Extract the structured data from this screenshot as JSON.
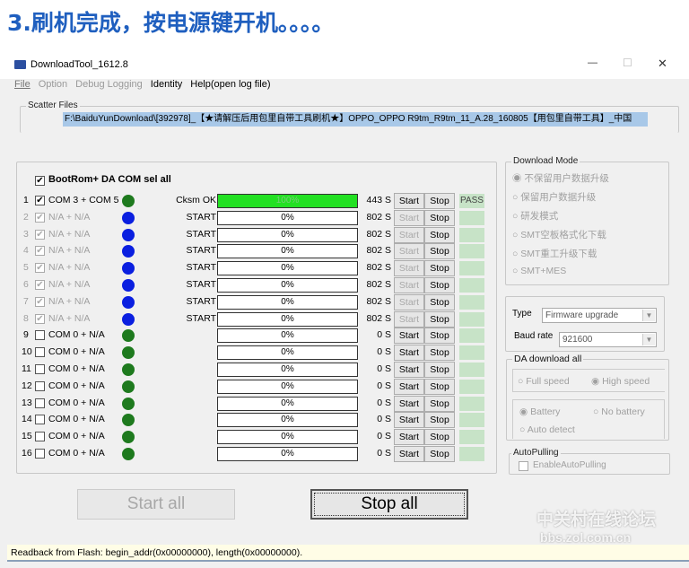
{
  "caption": "3.刷机完成，按电源键开机。。。。",
  "window": {
    "title": "DownloadTool_1612.8",
    "minimize": "—",
    "maximize": "☐",
    "close": "✕"
  },
  "menu": [
    "File",
    "Option",
    "Debug Logging",
    "Identity",
    "Help(open log file)"
  ],
  "scatter": {
    "label": "Scatter Files",
    "path": "F:\\BaiduYunDownload\\[392978]_【★请解压后用包里自带工具刷机★】OPPO_OPPO R9tm_R9tm_11_A.28_160805【用包里自带工具】_中国"
  },
  "sel_all": {
    "label": "BootRom+ DA COM sel all",
    "checked": true
  },
  "rows": [
    {
      "n": "1",
      "com": "COM 3 + COM 5",
      "checked": true,
      "enabled": true,
      "led": "#1e7a1e",
      "status": "Cksm OK",
      "progress": 100,
      "pct": "100%",
      "time": "443 S",
      "start_enabled": true,
      "result": "PASS"
    },
    {
      "n": "2",
      "com": "N/A + N/A",
      "checked": true,
      "enabled": false,
      "led": "#0a1fe0",
      "status": "START",
      "progress": 0,
      "pct": "0%",
      "time": "802 S",
      "start_enabled": false,
      "result": ""
    },
    {
      "n": "3",
      "com": "N/A + N/A",
      "checked": true,
      "enabled": false,
      "led": "#0a1fe0",
      "status": "START",
      "progress": 0,
      "pct": "0%",
      "time": "802 S",
      "start_enabled": false,
      "result": ""
    },
    {
      "n": "4",
      "com": "N/A + N/A",
      "checked": true,
      "enabled": false,
      "led": "#0a1fe0",
      "status": "START",
      "progress": 0,
      "pct": "0%",
      "time": "802 S",
      "start_enabled": false,
      "result": ""
    },
    {
      "n": "5",
      "com": "N/A + N/A",
      "checked": true,
      "enabled": false,
      "led": "#0a1fe0",
      "status": "START",
      "progress": 0,
      "pct": "0%",
      "time": "802 S",
      "start_enabled": false,
      "result": ""
    },
    {
      "n": "6",
      "com": "N/A + N/A",
      "checked": true,
      "enabled": false,
      "led": "#0a1fe0",
      "status": "START",
      "progress": 0,
      "pct": "0%",
      "time": "802 S",
      "start_enabled": false,
      "result": ""
    },
    {
      "n": "7",
      "com": "N/A + N/A",
      "checked": true,
      "enabled": false,
      "led": "#0a1fe0",
      "status": "START",
      "progress": 0,
      "pct": "0%",
      "time": "802 S",
      "start_enabled": false,
      "result": ""
    },
    {
      "n": "8",
      "com": "N/A + N/A",
      "checked": true,
      "enabled": false,
      "led": "#0a1fe0",
      "status": "START",
      "progress": 0,
      "pct": "0%",
      "time": "802 S",
      "start_enabled": false,
      "result": ""
    },
    {
      "n": "9",
      "com": "COM 0 + N/A",
      "checked": false,
      "enabled": true,
      "led": "#1e7a1e",
      "status": "",
      "progress": 0,
      "pct": "0%",
      "time": "0 S",
      "start_enabled": true,
      "result": ""
    },
    {
      "n": "10",
      "com": "COM 0 + N/A",
      "checked": false,
      "enabled": true,
      "led": "#1e7a1e",
      "status": "",
      "progress": 0,
      "pct": "0%",
      "time": "0 S",
      "start_enabled": true,
      "result": ""
    },
    {
      "n": "11",
      "com": "COM 0 + N/A",
      "checked": false,
      "enabled": true,
      "led": "#1e7a1e",
      "status": "",
      "progress": 0,
      "pct": "0%",
      "time": "0 S",
      "start_enabled": true,
      "result": ""
    },
    {
      "n": "12",
      "com": "COM 0 + N/A",
      "checked": false,
      "enabled": true,
      "led": "#1e7a1e",
      "status": "",
      "progress": 0,
      "pct": "0%",
      "time": "0 S",
      "start_enabled": true,
      "result": ""
    },
    {
      "n": "13",
      "com": "COM 0 + N/A",
      "checked": false,
      "enabled": true,
      "led": "#1e7a1e",
      "status": "",
      "progress": 0,
      "pct": "0%",
      "time": "0 S",
      "start_enabled": true,
      "result": ""
    },
    {
      "n": "14",
      "com": "COM 0 + N/A",
      "checked": false,
      "enabled": true,
      "led": "#1e7a1e",
      "status": "",
      "progress": 0,
      "pct": "0%",
      "time": "0 S",
      "start_enabled": true,
      "result": ""
    },
    {
      "n": "15",
      "com": "COM 0 + N/A",
      "checked": false,
      "enabled": true,
      "led": "#1e7a1e",
      "status": "",
      "progress": 0,
      "pct": "0%",
      "time": "0 S",
      "start_enabled": true,
      "result": ""
    },
    {
      "n": "16",
      "com": "COM 0 + N/A",
      "checked": false,
      "enabled": true,
      "led": "#1e7a1e",
      "status": "",
      "progress": 0,
      "pct": "0%",
      "time": "0 S",
      "start_enabled": true,
      "result": ""
    }
  ],
  "row_buttons": {
    "start": "Start",
    "stop": "Stop"
  },
  "download_mode": {
    "label": "Download Mode",
    "options": [
      "不保留用户数据升级",
      "保留用户数据升级",
      "研发模式",
      "SMT空板格式化下载",
      "SMT重工升级下载",
      "SMT+MES"
    ],
    "selected": 0
  },
  "type": {
    "label": "Type",
    "value": "Firmware upgrade"
  },
  "baud": {
    "label": "Baud rate",
    "value": "921600"
  },
  "da": {
    "label": "DA download all",
    "full": "Full speed",
    "high": "High speed",
    "battery": "Battery",
    "no_battery": "No battery",
    "auto": "Auto detect"
  },
  "autopulling": {
    "label": "AutoPulling",
    "check": "EnableAutoPulling"
  },
  "start_all": "Start all",
  "stop_all": "Stop all",
  "status": "Readback from Flash:  begin_addr(0x00000000), length(0x00000000).",
  "watermark": {
    "cn": "中关村在线论坛",
    "url": "bbs.zol.com.cn"
  },
  "colors": {
    "progress_fill": "#22e022",
    "pass": "#c7e3c7",
    "caption": "#1f5fbf"
  }
}
